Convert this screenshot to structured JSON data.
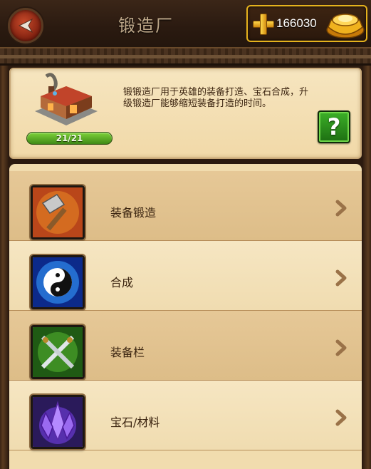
{
  "header": {
    "title": "锻造厂",
    "back_icon": "back-arrow-icon",
    "currency": {
      "value": "166030",
      "add_icon": "plus-icon",
      "currency_icon": "gold-ingot-icon"
    }
  },
  "info": {
    "description": "锻锻造厂用于英雄的装备打造、宝石合成，升级锻造厂能够缩短装备打造的时间。",
    "level_text": "21/21",
    "help_label": "?",
    "building_icon": "forge-building-icon"
  },
  "menu": {
    "items": [
      {
        "label": "装备锻造",
        "icon": "hammer-icon"
      },
      {
        "label": "合成",
        "icon": "yin-yang-icon"
      },
      {
        "label": "装备栏",
        "icon": "crossed-swords-icon"
      },
      {
        "label": "宝石/材料",
        "icon": "crystal-icon"
      }
    ]
  },
  "colors": {
    "accent_gold": "#e5b21d",
    "panel_bg": "#f1dcae",
    "help_green": "#2a9a1c",
    "text_brown": "#3b2410"
  }
}
